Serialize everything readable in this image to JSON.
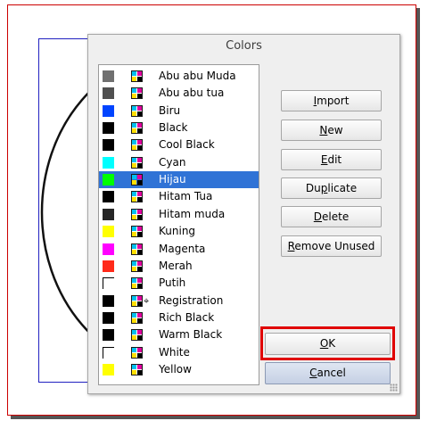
{
  "dialog": {
    "title": "Colors"
  },
  "colors": [
    {
      "name": "Abu abu Muda",
      "swatch": "#707070",
      "selected": false,
      "registration": false
    },
    {
      "name": "Abu abu tua",
      "swatch": "#505050",
      "selected": false,
      "registration": false
    },
    {
      "name": "Biru",
      "swatch": "#0044ff",
      "selected": false,
      "registration": false
    },
    {
      "name": "Black",
      "swatch": "#000000",
      "selected": false,
      "registration": false
    },
    {
      "name": "Cool Black",
      "swatch": "#000000",
      "selected": false,
      "registration": false
    },
    {
      "name": "Cyan",
      "swatch": "#00ffff",
      "selected": false,
      "registration": false
    },
    {
      "name": "Hijau",
      "swatch": "#00ff00",
      "selected": true,
      "registration": false
    },
    {
      "name": "Hitam Tua",
      "swatch": "#000000",
      "selected": false,
      "registration": false
    },
    {
      "name": "Hitam muda",
      "swatch": "#262626",
      "selected": false,
      "registration": false
    },
    {
      "name": "Kuning",
      "swatch": "#ffff00",
      "selected": false,
      "registration": false
    },
    {
      "name": "Magenta",
      "swatch": "#ff00ff",
      "selected": false,
      "registration": false
    },
    {
      "name": "Merah",
      "swatch": "#ff2a1a",
      "selected": false,
      "registration": false
    },
    {
      "name": "Putih",
      "swatch": "#ffffff",
      "selected": false,
      "registration": false
    },
    {
      "name": "Registration",
      "swatch": "#000000",
      "selected": false,
      "registration": true
    },
    {
      "name": "Rich Black",
      "swatch": "#000000",
      "selected": false,
      "registration": false
    },
    {
      "name": "Warm Black",
      "swatch": "#000000",
      "selected": false,
      "registration": false
    },
    {
      "name": "White",
      "swatch": "#ffffff",
      "selected": false,
      "registration": false
    },
    {
      "name": "Yellow",
      "swatch": "#ffff00",
      "selected": false,
      "registration": false
    }
  ],
  "buttons": {
    "import": {
      "label": "Import",
      "mnemonic": "I"
    },
    "new": {
      "label": "New",
      "mnemonic": "N"
    },
    "edit": {
      "label": "Edit",
      "mnemonic": "E"
    },
    "duplicate": {
      "label": "Duplicate",
      "mnemonic": "p"
    },
    "delete": {
      "label": "Delete",
      "mnemonic": "D"
    },
    "remove_unused": {
      "label": "Remove Unused",
      "mnemonic": "R"
    },
    "ok": {
      "label": "OK",
      "mnemonic": "O"
    },
    "cancel": {
      "label": "Cancel",
      "mnemonic": "C"
    }
  },
  "theme": {
    "selection_color": "#3073d6",
    "highlight_color": "#e00000"
  }
}
